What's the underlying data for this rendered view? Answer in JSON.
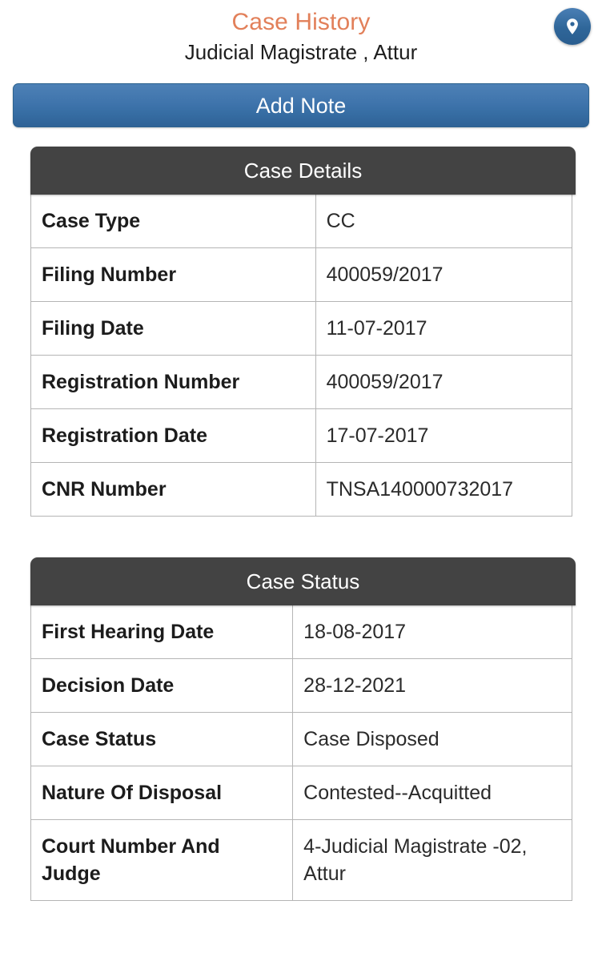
{
  "header": {
    "title": "Case History",
    "subtitle": "Judicial Magistrate , Attur",
    "title_color": "#e2805a",
    "pin_icon": "location-pin-icon"
  },
  "actions": {
    "add_note_label": "Add Note",
    "add_note_color": "#3f74ac"
  },
  "cards": [
    {
      "id": "case-details",
      "header": "Case Details",
      "header_color": "#434343",
      "rows": [
        {
          "label": "Case Type",
          "value": "CC"
        },
        {
          "label": "Filing Number",
          "value": "400059/2017"
        },
        {
          "label": "Filing Date",
          "value": "11-07-2017"
        },
        {
          "label": "Registration Number",
          "value": "400059/2017"
        },
        {
          "label": "Registration Date",
          "value": "17-07-2017"
        },
        {
          "label": "CNR Number",
          "value": "TNSA140000732017"
        }
      ]
    },
    {
      "id": "case-status",
      "header": "Case Status",
      "header_color": "#434343",
      "rows": [
        {
          "label": "First Hearing Date",
          "value": "18-08-2017"
        },
        {
          "label": "Decision Date",
          "value": "28-12-2021"
        },
        {
          "label": "Case Status",
          "value": "Case Disposed"
        },
        {
          "label": "Nature Of Disposal",
          "value": "Contested--Acquitted"
        },
        {
          "label": "Court Number And Judge",
          "value": "4-Judicial Magistrate -02, Attur"
        }
      ]
    }
  ]
}
